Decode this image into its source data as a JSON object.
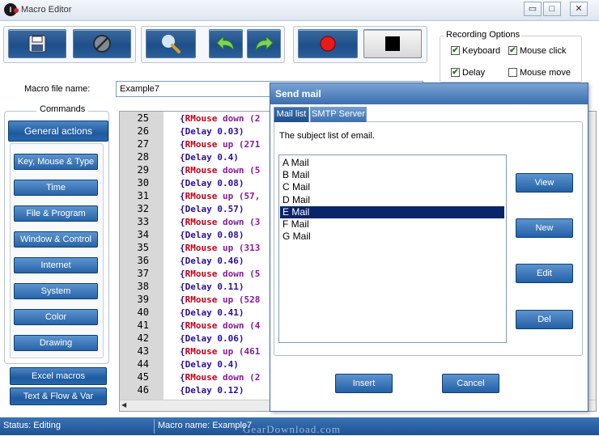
{
  "window": {
    "title": "Macro Editor",
    "minimize": "▭",
    "maximize": "□",
    "close": "✕"
  },
  "toolbar": {
    "save_icon": "floppy-disk-icon",
    "cancel_icon": "no-entry-icon",
    "search_icon": "magnifier-icon",
    "undo_icon": "undo-arrow-icon",
    "redo_icon": "redo-arrow-icon",
    "record_icon": "record-icon",
    "stop_icon": "stop-icon"
  },
  "recording_options": {
    "title": "Recording Options",
    "keyboard": {
      "label": "Keyboard",
      "checked": true
    },
    "mouse_click": {
      "label": "Mouse click",
      "checked": true
    },
    "delay": {
      "label": "Delay",
      "checked": true
    },
    "mouse_move": {
      "label": "Mouse move",
      "checked": false
    }
  },
  "macro_file": {
    "label": "Macro file name:",
    "value": "Example7"
  },
  "commands": {
    "title": "Commands",
    "general_actions": "General actions",
    "items": [
      "Key, Mouse & Type",
      "Time",
      "File & Program",
      "Window & Control",
      "Internet",
      "System",
      "Color",
      "Drawing"
    ],
    "excel_macros": "Excel macros",
    "text_flow_var": "Text & Flow & Var"
  },
  "editor": {
    "lines": [
      {
        "n": "25",
        "kw": "RMouse",
        "rest": " down (2"
      },
      {
        "n": "26",
        "kw": "Delay",
        "rest": " 0.03)"
      },
      {
        "n": "27",
        "kw": "RMouse",
        "rest": " up (271"
      },
      {
        "n": "28",
        "kw": "Delay",
        "rest": " 0.4)"
      },
      {
        "n": "29",
        "kw": "RMouse",
        "rest": " down (5"
      },
      {
        "n": "30",
        "kw": "Delay",
        "rest": " 0.08)"
      },
      {
        "n": "31",
        "kw": "RMouse",
        "rest": " up (57,"
      },
      {
        "n": "32",
        "kw": "Delay",
        "rest": " 0.57)"
      },
      {
        "n": "33",
        "kw": "RMouse",
        "rest": " down (3"
      },
      {
        "n": "34",
        "kw": "Delay",
        "rest": " 0.08)"
      },
      {
        "n": "35",
        "kw": "RMouse",
        "rest": " up (313"
      },
      {
        "n": "36",
        "kw": "Delay",
        "rest": " 0.46)"
      },
      {
        "n": "37",
        "kw": "RMouse",
        "rest": " down (5"
      },
      {
        "n": "38",
        "kw": "Delay",
        "rest": " 0.11)"
      },
      {
        "n": "39",
        "kw": "RMouse",
        "rest": " up (528"
      },
      {
        "n": "40",
        "kw": "Delay",
        "rest": " 0.41)"
      },
      {
        "n": "41",
        "kw": "RMouse",
        "rest": " down (4"
      },
      {
        "n": "42",
        "kw": "Delay",
        "rest": " 0.06)"
      },
      {
        "n": "43",
        "kw": "RMouse",
        "rest": " up (461"
      },
      {
        "n": "44",
        "kw": "Delay",
        "rest": " 0.4)"
      },
      {
        "n": "45",
        "kw": "RMouse",
        "rest": " down (2"
      },
      {
        "n": "46",
        "kw": "Delay",
        "rest": " 0.12)"
      }
    ]
  },
  "dialog": {
    "title": "Send mail",
    "tabs": [
      "Mail list",
      "SMTP Server"
    ],
    "subject_label": "The subject list of email.",
    "mails": [
      "A Mail",
      "B Mail",
      "C Mail",
      "D Mail",
      "E Mail",
      "F Mail",
      "G Mail"
    ],
    "selected_index": 4,
    "buttons": {
      "view": "View",
      "new": "New",
      "edit": "Edit",
      "del": "Del"
    },
    "insert": "Insert",
    "cancel": "Cancel"
  },
  "status": {
    "left": "Status: Editing",
    "macro_name": "Macro name: Example7",
    "watermark": "GearDownload.com"
  }
}
